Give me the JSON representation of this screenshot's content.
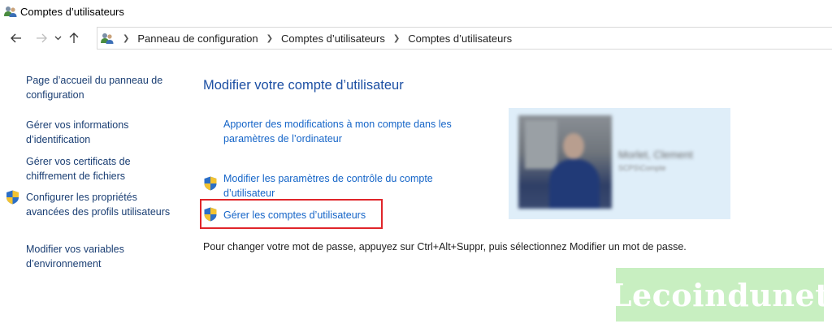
{
  "window": {
    "title": "Comptes d’utilisateurs",
    "app_icon": "users-icon"
  },
  "nav": {
    "back_icon": "arrow-left-icon",
    "forward_icon": "arrow-right-icon",
    "recent_icon": "chevron-down-icon",
    "up_icon": "arrow-up-icon"
  },
  "breadcrumb": {
    "items": [
      "Panneau de configuration",
      "Comptes d’utilisateurs",
      "Comptes d’utilisateurs"
    ]
  },
  "left_pane": {
    "links": [
      {
        "label": "Page d’accueil du panneau de configuration",
        "shield": false
      },
      {
        "label": "Gérer vos informations d’identification",
        "shield": false
      },
      {
        "label": "Gérer vos certificats de chiffrement de fichiers",
        "shield": false
      },
      {
        "label": "Configurer les propriétés avancées des profils utilisateurs",
        "shield": true
      },
      {
        "label": "Modifier vos variables d’environnement",
        "shield": false
      }
    ]
  },
  "main": {
    "heading": "Modifier votre compte d’utilisateur",
    "tasks": [
      {
        "label": "Apporter des modifications à mon compte dans les paramètres de l’ordinateur",
        "shield": false
      },
      {
        "label": "Modifier les paramètres de contrôle du compte d’utilisateur",
        "shield": true
      },
      {
        "label": "Gérer les comptes d’utilisateurs",
        "shield": true,
        "highlighted": true
      }
    ],
    "instruction": "Pour changer votre mot de passe, appuyez sur Ctrl+Alt+Suppr, puis sélectionnez Modifier un mot de passe."
  },
  "user_tile": {
    "name": "Morlet, Clement",
    "role": "SCPS\\Compte"
  },
  "watermark": {
    "text": "Lecoindunet"
  },
  "colors": {
    "link": "#1565c8",
    "heading": "#1c4fa3",
    "highlight": "#e0252a",
    "tile_bg": "#dfeef9",
    "watermark_bg": "#c8efc1"
  }
}
